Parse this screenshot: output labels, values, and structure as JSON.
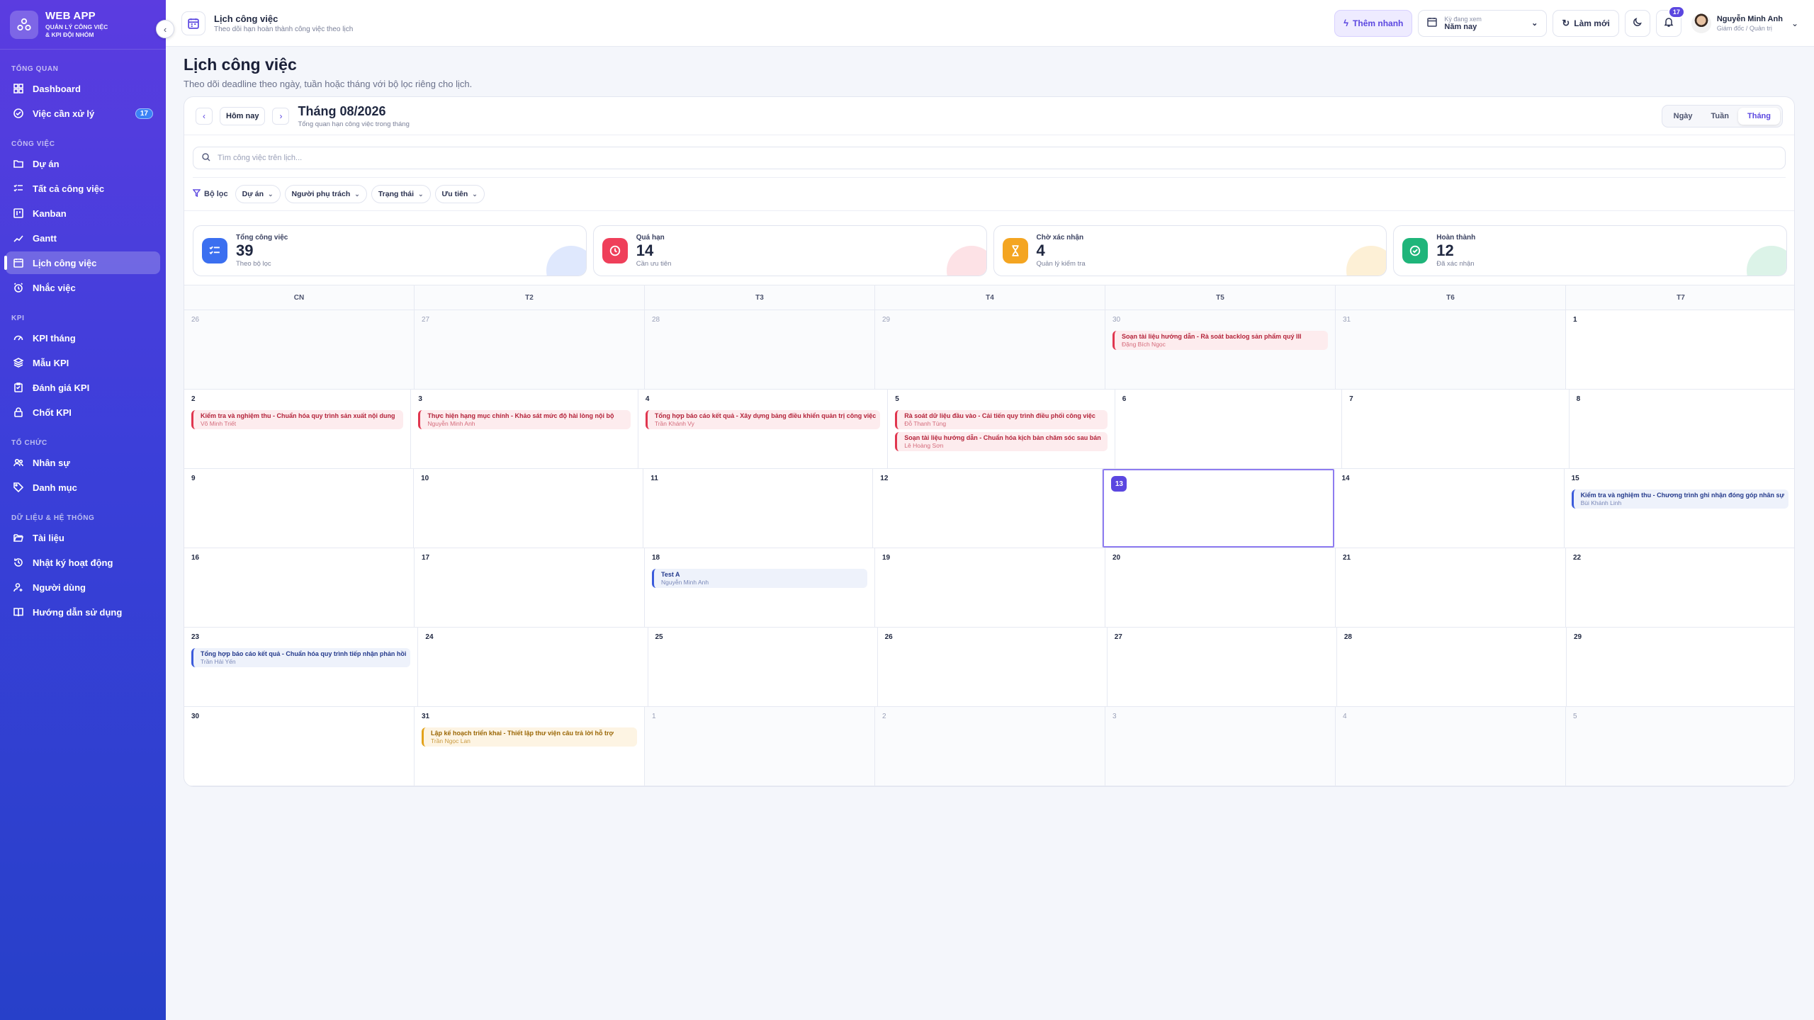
{
  "brand": {
    "title": "WEB APP",
    "subtitle": "QUẢN LÝ CÔNG VIỆC & KPI ĐỘI NHÓM"
  },
  "sidebar": {
    "sections": {
      "overview": "TỔNG QUAN",
      "work": "CÔNG VIỆC",
      "kpi": "KPI",
      "org": "TỔ CHỨC",
      "data": "DỮ LIỆU & HỆ THỐNG"
    },
    "items": {
      "dashboard": "Dashboard",
      "pending": "Việc cần xử lý",
      "pending_badge": "17",
      "projects": "Dự án",
      "all_tasks": "Tất cả công việc",
      "kanban": "Kanban",
      "gantt": "Gantt",
      "calendar": "Lịch công việc",
      "reminders": "Nhắc việc",
      "kpi_month": "KPI tháng",
      "kpi_template": "Mẫu KPI",
      "kpi_review": "Đánh giá KPI",
      "kpi_lock": "Chốt KPI",
      "staff": "Nhân sự",
      "catalog": "Danh mục",
      "docs": "Tài liệu",
      "activity": "Nhật ký hoạt động",
      "users": "Người dùng",
      "guide": "Hướng dẫn sử dụng"
    }
  },
  "topbar": {
    "title": "Lịch công việc",
    "subtitle": "Theo dõi hạn hoàn thành công việc theo lịch",
    "quick_add": "Thêm nhanh",
    "period_label": "Kỳ đang xem",
    "period_value": "Năm nay",
    "refresh": "Làm mới",
    "notif_count": "17",
    "user_name": "Nguyễn Minh Anh",
    "user_role": "Giám đốc / Quản trị"
  },
  "page": {
    "title": "Lịch công việc",
    "subtitle": "Theo dõi deadline theo ngày, tuần hoặc tháng với bộ lọc riêng cho lịch."
  },
  "calendar": {
    "today_btn": "Hôm nay",
    "month_title": "Tháng 08/2026",
    "month_sub": "Tổng quan hạn công việc trong tháng",
    "views": [
      "Ngày",
      "Tuần",
      "Tháng"
    ],
    "search_placeholder": "Tìm công việc trên lịch...",
    "filter_label": "Bộ lọc",
    "filters": [
      "Dự án",
      "Người phụ trách",
      "Trạng thái",
      "Ưu tiên"
    ],
    "stats": [
      {
        "label": "Tổng công việc",
        "value": "39",
        "hint": "Theo bộ lọc",
        "color": "#3b6ff0",
        "blob": "#dfe8fd",
        "icon": "list-check-icon"
      },
      {
        "label": "Quá hạn",
        "value": "14",
        "hint": "Cần ưu tiên",
        "color": "#ef3f5a",
        "blob": "#fde2e6",
        "icon": "clock-icon"
      },
      {
        "label": "Chờ xác nhận",
        "value": "4",
        "hint": "Quản lý kiểm tra",
        "color": "#f4a521",
        "blob": "#fdf0d6",
        "icon": "hourglass-icon"
      },
      {
        "label": "Hoàn thành",
        "value": "12",
        "hint": "Đã xác nhận",
        "color": "#1fb57a",
        "blob": "#dcf3e8",
        "icon": "check-circle-icon"
      }
    ],
    "weekdays": [
      "CN",
      "T2",
      "T3",
      "T4",
      "T5",
      "T6",
      "T7"
    ],
    "weeks": [
      [
        {
          "d": "26",
          "out": true
        },
        {
          "d": "27",
          "out": true
        },
        {
          "d": "28",
          "out": true
        },
        {
          "d": "29",
          "out": true
        },
        {
          "d": "30",
          "out": true,
          "events": [
            {
              "t": "Soạn tài liệu hướng dẫn - Rà soát backlog sản phẩm quý III",
              "p": "Đặng Bích Ngọc",
              "c": "red"
            }
          ]
        },
        {
          "d": "31",
          "out": true
        },
        {
          "d": "1"
        }
      ],
      [
        {
          "d": "2",
          "events": [
            {
              "t": "Kiểm tra và nghiệm thu - Chuẩn hóa quy trình sản xuất nội dung",
              "p": "Võ Minh Triết",
              "c": "red"
            }
          ]
        },
        {
          "d": "3",
          "events": [
            {
              "t": "Thực hiện hạng mục chính - Khảo sát mức độ hài lòng nội bộ",
              "p": "Nguyễn Minh Anh",
              "c": "red"
            }
          ]
        },
        {
          "d": "4",
          "events": [
            {
              "t": "Tổng hợp báo cáo kết quả - Xây dựng bảng điều khiển quản trị công việc",
              "p": "Trần Khánh Vy",
              "c": "red"
            }
          ]
        },
        {
          "d": "5",
          "events": [
            {
              "t": "Rà soát dữ liệu đầu vào - Cải tiến quy trình điều phối công việc",
              "p": "Đỗ Thanh Tùng",
              "c": "red"
            },
            {
              "t": "Soạn tài liệu hướng dẫn - Chuẩn hóa kịch bản chăm sóc sau bán",
              "p": "Lê Hoàng Sơn",
              "c": "red"
            }
          ]
        },
        {
          "d": "6"
        },
        {
          "d": "7"
        },
        {
          "d": "8"
        }
      ],
      [
        {
          "d": "9"
        },
        {
          "d": "10"
        },
        {
          "d": "11"
        },
        {
          "d": "12"
        },
        {
          "d": "13",
          "today": true
        },
        {
          "d": "14"
        },
        {
          "d": "15",
          "events": [
            {
              "t": "Kiểm tra và nghiệm thu - Chương trình ghi nhận đóng góp nhân sự",
              "p": "Bùi Khánh Linh",
              "c": "blue"
            }
          ]
        }
      ],
      [
        {
          "d": "16"
        },
        {
          "d": "17"
        },
        {
          "d": "18",
          "events": [
            {
              "t": "Test A",
              "p": "Nguyễn Minh Anh",
              "c": "blue"
            }
          ]
        },
        {
          "d": "19"
        },
        {
          "d": "20"
        },
        {
          "d": "21"
        },
        {
          "d": "22"
        }
      ],
      [
        {
          "d": "23",
          "events": [
            {
              "t": "Tổng hợp báo cáo kết quả - Chuẩn hóa quy trình tiếp nhận phản hồi",
              "p": "Trần Hải Yến",
              "c": "blue"
            }
          ]
        },
        {
          "d": "24"
        },
        {
          "d": "25"
        },
        {
          "d": "26"
        },
        {
          "d": "27"
        },
        {
          "d": "28"
        },
        {
          "d": "29"
        }
      ],
      [
        {
          "d": "30"
        },
        {
          "d": "31",
          "events": [
            {
              "t": "Lập kế hoạch triển khai - Thiết lập thư viện câu trả lời hỗ trợ",
              "p": "Trần Ngọc Lan",
              "c": "amber"
            }
          ]
        },
        {
          "d": "1",
          "out": true
        },
        {
          "d": "2",
          "out": true
        },
        {
          "d": "3",
          "out": true
        },
        {
          "d": "4",
          "out": true
        },
        {
          "d": "5",
          "out": true
        }
      ]
    ]
  }
}
